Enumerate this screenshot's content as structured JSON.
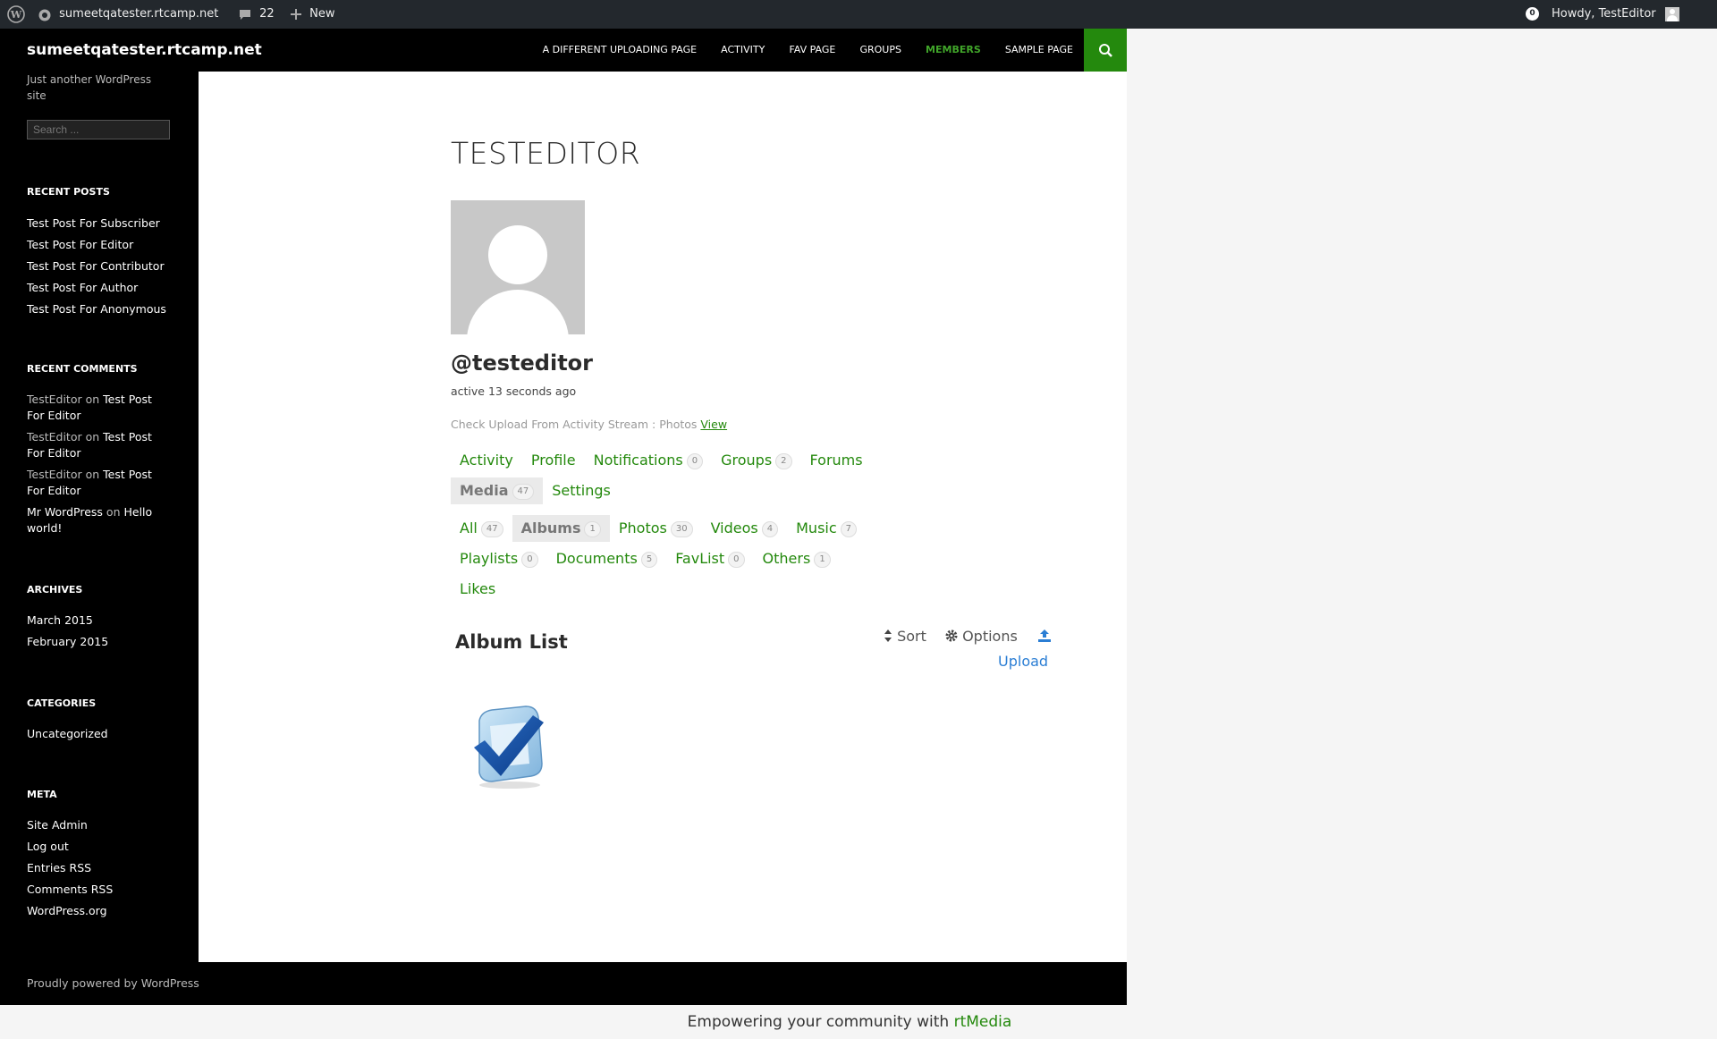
{
  "admin_bar": {
    "site_name": "sumeetqatester.rtcamp.net",
    "comment_count": "22",
    "new_label": "New",
    "notification_count": "0",
    "howdy": "Howdy, TestEditor"
  },
  "header": {
    "site_title": "sumeetqatester.rtcamp.net",
    "nav": [
      "A DIFFERENT UPLOADING PAGE",
      "ACTIVITY",
      "FAV PAGE",
      "GROUPS",
      "MEMBERS",
      "SAMPLE PAGE"
    ],
    "current_nav": "MEMBERS"
  },
  "sidebar": {
    "description": "Just another WordPress site",
    "search_placeholder": "Search ...",
    "recent_posts_title": "RECENT POSTS",
    "recent_posts": [
      "Test Post For Subscriber",
      "Test Post For Editor",
      "Test Post For Contributor",
      "Test Post For Author",
      "Test Post For Anonymous"
    ],
    "recent_comments_title": "RECENT COMMENTS",
    "recent_comments": [
      {
        "author": "TestEditor",
        "on": "on",
        "post": "Test Post For Editor"
      },
      {
        "author": "TestEditor",
        "on": "on",
        "post": "Test Post For Editor"
      },
      {
        "author": "TestEditor",
        "on": "on",
        "post": "Test Post For Editor"
      },
      {
        "author": "Mr WordPress",
        "on": "on",
        "post": "Hello world!"
      }
    ],
    "archives_title": "ARCHIVES",
    "archives": [
      "March 2015",
      "February 2015"
    ],
    "categories_title": "CATEGORIES",
    "categories": [
      "Uncategorized"
    ],
    "meta_title": "META",
    "meta": [
      "Site Admin",
      "Log out",
      "Entries RSS",
      "Comments RSS",
      "WordPress.org"
    ]
  },
  "profile": {
    "title": "TESTEDITOR",
    "handle": "@testeditor",
    "active": "active 13 seconds ago",
    "latest_update": "Check Upload From Activity Stream : Photos",
    "view_link": "View"
  },
  "tabs": {
    "main_row1": [
      {
        "label": "Activity",
        "count": null
      },
      {
        "label": "Profile",
        "count": null
      },
      {
        "label": "Notifications",
        "count": "0"
      },
      {
        "label": "Groups",
        "count": "2"
      },
      {
        "label": "Forums",
        "count": null
      }
    ],
    "main_row2": [
      {
        "label": "Media",
        "count": "47",
        "selected": true
      },
      {
        "label": "Settings",
        "count": null
      }
    ],
    "media_row1": [
      {
        "label": "All",
        "count": "47"
      },
      {
        "label": "Albums",
        "count": "1",
        "selected": true
      },
      {
        "label": "Photos",
        "count": "30"
      },
      {
        "label": "Videos",
        "count": "4"
      },
      {
        "label": "Music",
        "count": "7"
      }
    ],
    "media_row2": [
      {
        "label": "Playlists",
        "count": "0"
      },
      {
        "label": "Documents",
        "count": "5"
      },
      {
        "label": "FavList",
        "count": "0"
      },
      {
        "label": "Others",
        "count": "1"
      }
    ],
    "media_row3": [
      {
        "label": "Likes",
        "count": null
      }
    ]
  },
  "album": {
    "title": "Album List",
    "sort": "Sort",
    "options": "Options",
    "upload": "Upload"
  },
  "footer": {
    "powered": "Proudly powered by WordPress",
    "rt_prefix": "Empowering your community with",
    "rt_link": "rtMedia"
  },
  "colors": {
    "accent": "#24890d",
    "link_blue": "#2b7ed4"
  }
}
